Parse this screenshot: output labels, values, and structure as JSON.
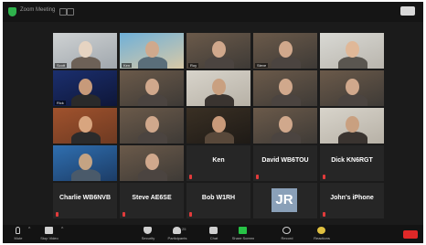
{
  "window": {
    "title": "Zoom Meeting"
  },
  "tiles": [
    {
      "name": "Scott",
      "type": "video",
      "scene": "bright"
    },
    {
      "name": "Ken",
      "type": "video",
      "scene": "beach"
    },
    {
      "name": "Roy",
      "type": "video",
      "scene": "room"
    },
    {
      "name": "Steve",
      "type": "video",
      "scene": "room"
    },
    {
      "name": "",
      "type": "video",
      "scene": "wall"
    },
    {
      "name": "Rick",
      "type": "video",
      "scene": "space"
    },
    {
      "name": "",
      "type": "video",
      "scene": "room"
    },
    {
      "name": "",
      "type": "video",
      "scene": "light"
    },
    {
      "name": "",
      "type": "video",
      "scene": "room"
    },
    {
      "name": "",
      "type": "video",
      "scene": "room",
      "active": true
    },
    {
      "name": "",
      "type": "video",
      "scene": "warm"
    },
    {
      "name": "",
      "type": "video",
      "scene": "room"
    },
    {
      "name": "",
      "type": "video",
      "scene": "dark"
    },
    {
      "name": "",
      "type": "video",
      "scene": "room"
    },
    {
      "name": "",
      "type": "video",
      "scene": "light"
    },
    {
      "name": "",
      "type": "video",
      "scene": "blue"
    },
    {
      "name": "",
      "type": "video",
      "scene": "room"
    },
    {
      "name": "Ken",
      "type": "name"
    },
    {
      "name": "David WB6TOU",
      "type": "name"
    },
    {
      "name": "Dick KN6RGT",
      "type": "name"
    },
    {
      "name": "Charlie WB6NVB",
      "type": "name"
    },
    {
      "name": "Steve AE6SE",
      "type": "name"
    },
    {
      "name": "Bob W1RH",
      "type": "name"
    },
    {
      "name": "",
      "type": "avatar",
      "initials": "JR"
    },
    {
      "name": "John's iPhone",
      "type": "name"
    }
  ],
  "toolbar": {
    "mute": "Mute",
    "video": "Stop Video",
    "security": "Security",
    "participants": "Participants",
    "participants_count": "25",
    "chat": "Chat",
    "share": "Share Screen",
    "record": "Record",
    "reactions": "Reactions",
    "end": "End"
  },
  "colors": {
    "active_speaker": "#3fcf5a",
    "share": "#27c346",
    "end": "#e02828"
  }
}
